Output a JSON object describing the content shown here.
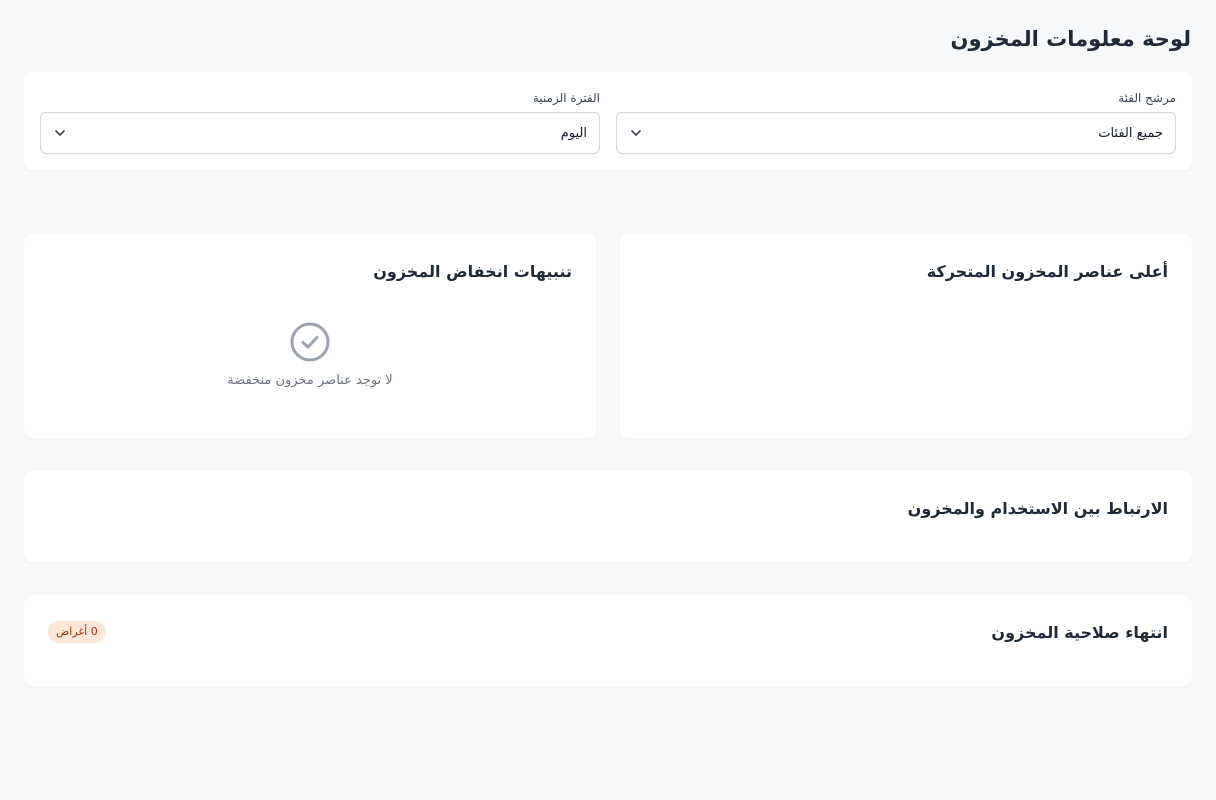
{
  "page": {
    "title": "لوحة معلومات المخزون"
  },
  "filters": {
    "category": {
      "label": "مرشح الفئة",
      "value": "جميع الفئات"
    },
    "period": {
      "label": "الفترة الزمنية",
      "value": "اليوم"
    }
  },
  "top_movers": {
    "title": "أعلى عناصر المخزون المتحركة"
  },
  "low_stock": {
    "title": "تنبيهات انخفاض المخزون",
    "empty_text": "لا توجد عناصر مخزون منخفضة",
    "empty_icon": "check-circle-icon"
  },
  "correlation": {
    "title": "الارتباط بين الاستخدام والمخزون"
  },
  "expiry": {
    "title": "انتهاء صلاحية المخزون",
    "badge": "0 أغراض"
  },
  "icons": {
    "select_arrow": "chevron-down-icon"
  },
  "colors": {
    "background": "#f7f8fa",
    "card": "#ffffff",
    "badge_bg": "#fde7d8",
    "badge_text": "#9a3412",
    "muted_icon": "#9ca3af"
  }
}
